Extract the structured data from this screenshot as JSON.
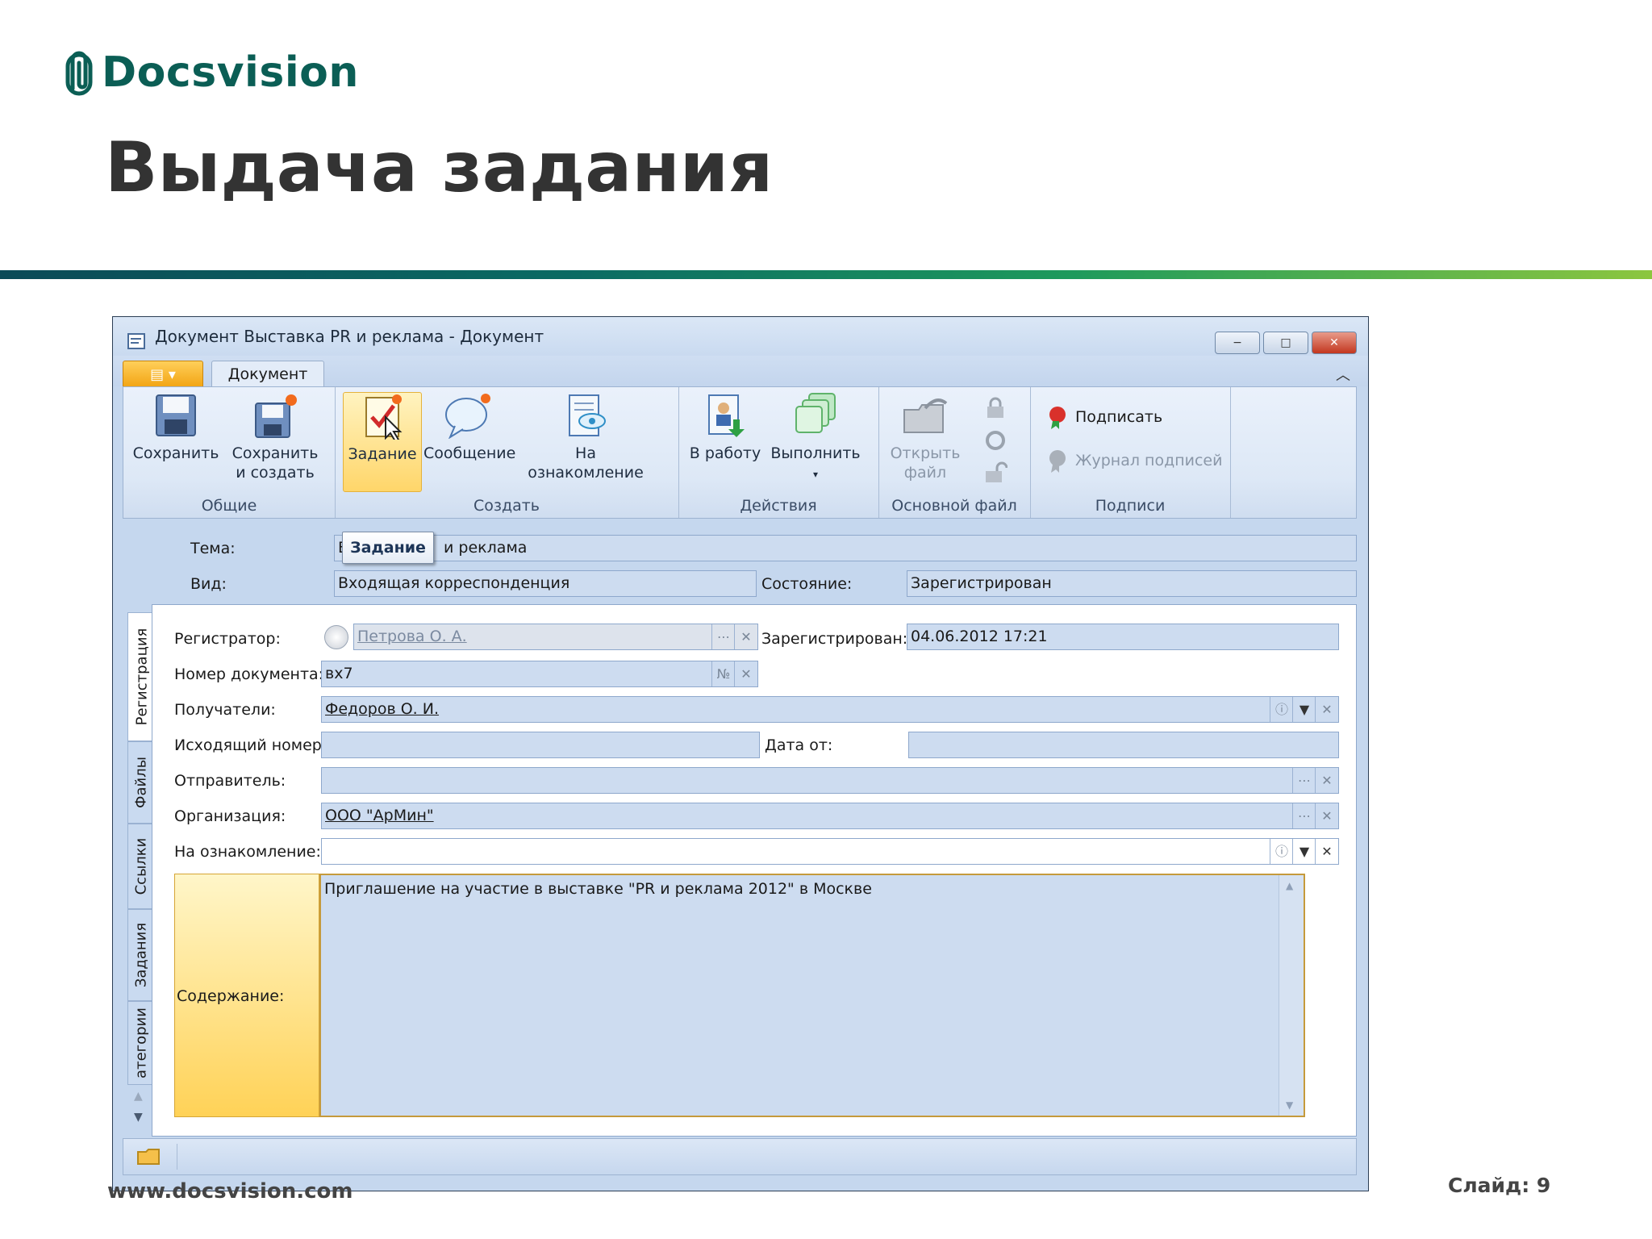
{
  "slide": {
    "brand": "Docsvision",
    "title": "Выдача задания",
    "footer_url": "www.docsvision.com",
    "slide_number": "Слайд: 9"
  },
  "window": {
    "title": "Документ Выставка PR и реклама - Документ",
    "tab": "Документ",
    "buttons": {
      "minimize": "−",
      "maximize": "□",
      "close": "✕"
    }
  },
  "ribbon": {
    "groups": {
      "general": "Общие",
      "create": "Создать",
      "actions": "Действия",
      "main_file": "Основной файл",
      "signatures": "Подписи"
    },
    "save": "Сохранить",
    "save_create_1": "Сохранить",
    "save_create_2": "и создать",
    "task": "Задание",
    "message": "Сообщение",
    "acquaint": "На ознакомление",
    "to_work": "В работу",
    "execute": "Выполнить",
    "open_file_1": "Открыть",
    "open_file_2": "файл",
    "sign": "Подписать",
    "sign_log": "Журнал подписей"
  },
  "tooltip": "Задание",
  "form": {
    "subject_label": "Тема:",
    "subject_value_start": "В",
    "subject_value_end": "и реклама",
    "kind_label": "Вид:",
    "kind_value": "Входящая корреспонденция",
    "state_label": "Состояние:",
    "state_value": "Зарегистрирован",
    "registrar_label": "Регистратор:",
    "registrar_value": "Петрова О. А.",
    "registered_label": "Зарегистрирован:",
    "registered_value": "04.06.2012 17:21",
    "docnum_label": "Номер документа:",
    "docnum_value": "вх7",
    "docnum_btn": "№",
    "recipients_label": "Получатели:",
    "recipients_value": "Федоров О. И.",
    "outnum_label": "Исходящий номер:",
    "outnum_value": "",
    "date_from_label": "Дата от:",
    "date_from_value": "",
    "sender_label": "Отправитель:",
    "sender_value": "",
    "org_label": "Организация:",
    "org_value": "ООО \"АрМин\"",
    "acq_label": "На ознакомление:",
    "acq_value": "",
    "content_label": "Содержание:",
    "content_value": "Приглашение на участие в выставке \"PR и реклама 2012\" в Москве"
  },
  "side_tabs": [
    "Регистрация",
    "Файлы",
    "Ссылки",
    "Задания",
    "атегории"
  ],
  "colors": {
    "brand": "#0b5e55",
    "title": "#333333",
    "accent_orange": "#f2a412"
  }
}
